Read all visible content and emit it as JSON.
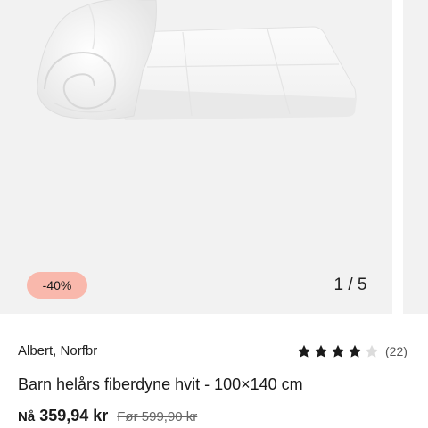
{
  "gallery": {
    "discount_badge": "-40%",
    "pager": "1 / 5",
    "current_slide": 1,
    "total_slides": 5,
    "badge_color": "#f9b8ac",
    "background_color": "#f2f2f2"
  },
  "product": {
    "brand": "Albert, Norfbr",
    "rating": 4,
    "rating_max": 5,
    "review_count": "(22)",
    "title": "Barn helårs fiberdyne hvit - 100×140 cm",
    "price_now_label": "Nå",
    "price_now": "359,94 kr",
    "price_before": "Før 599,90 kr"
  },
  "icons": {
    "star_filled": "star-icon",
    "star_empty": "star-empty-icon"
  }
}
